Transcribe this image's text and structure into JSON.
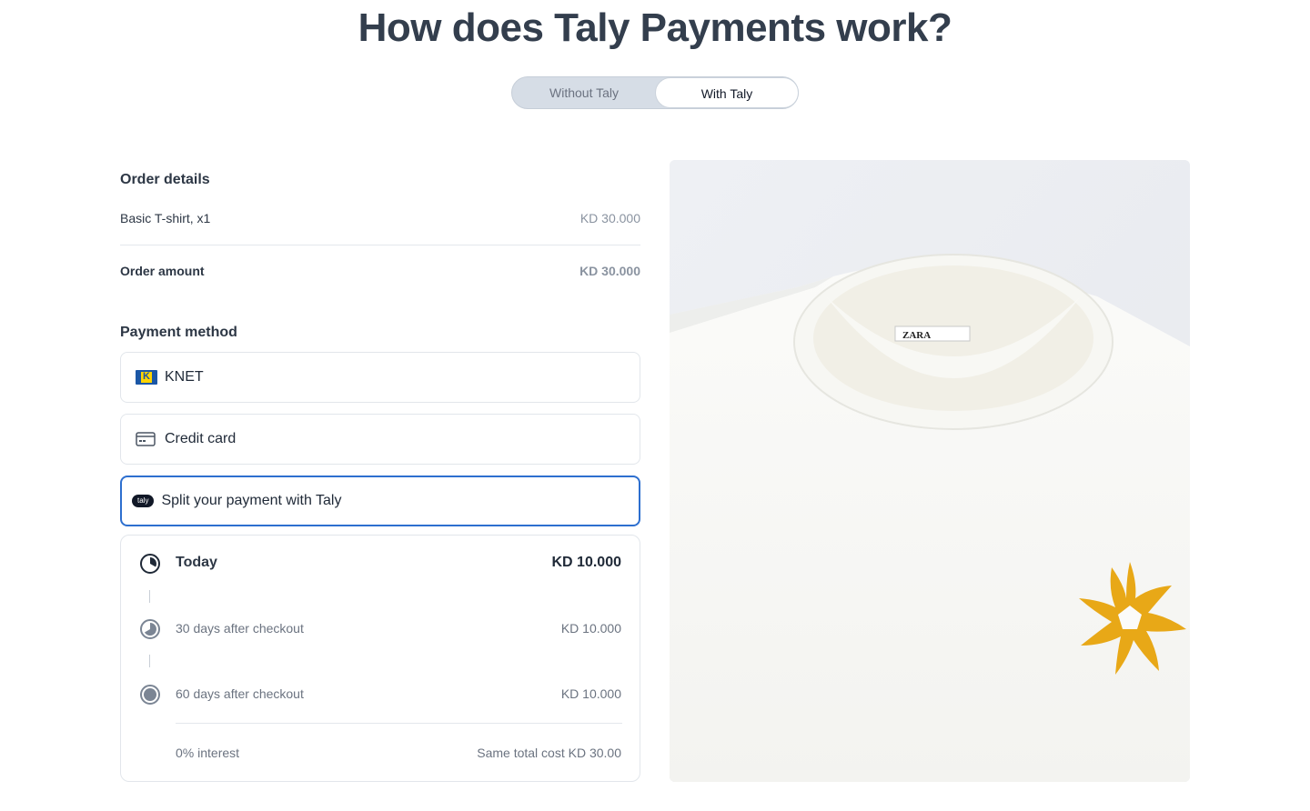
{
  "page": {
    "headline": "How does Taly Payments work?"
  },
  "toggle": {
    "without_label": "Without Taly",
    "with_label": "With Taly",
    "selected": "With Taly"
  },
  "order": {
    "title": "Order details",
    "item_name": "Basic T-shirt, x1",
    "item_price": "KD 30.000",
    "amount_label": "Order amount",
    "amount_value": "KD 30.000"
  },
  "payment": {
    "title": "Payment method",
    "options": [
      {
        "label": "KNET",
        "icon": "knet-logo-icon"
      },
      {
        "label": "Credit card",
        "icon": "credit-card-icon"
      },
      {
        "label": "Split your payment with Taly",
        "icon": "taly-logo-icon",
        "badge": "taly",
        "selected": true
      }
    ]
  },
  "plan": {
    "installments": [
      {
        "label": "Today",
        "amount": "KD 10.000",
        "progress": "1/3"
      },
      {
        "label": "30 days after checkout",
        "amount": "KD 10.000",
        "progress": "2/3"
      },
      {
        "label": "60 days after checkout",
        "amount": "KD 10.000",
        "progress": "3/3"
      }
    ],
    "interest": "0% interest",
    "total": "Same total cost KD 30.00"
  },
  "image": {
    "label_text": "ZARA"
  },
  "colors": {
    "accent": "#2d6fcf",
    "heading": "#333e4d",
    "toggle_bg": "#d6dde6",
    "taly_yellow": "#e8a817"
  }
}
